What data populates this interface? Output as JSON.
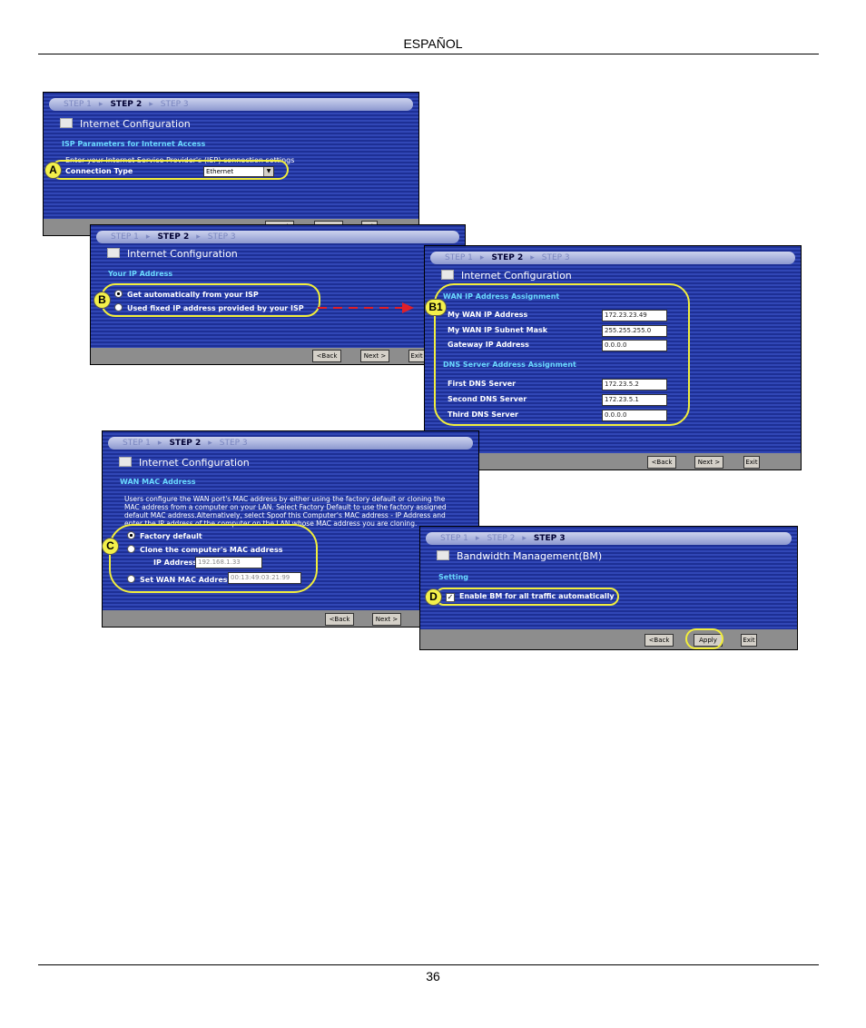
{
  "header": {
    "language": "ESPAÑOL"
  },
  "footer": {
    "page_number": "36"
  },
  "colors": {
    "highlight": "#f2ee3c",
    "window_blue": "#2a3ea8",
    "section_text": "#6ad9ff",
    "arrow": "#e0202a"
  },
  "steps": {
    "step1": "STEP 1",
    "step2": "STEP 2",
    "step3": "STEP 3"
  },
  "buttons": {
    "back": "<Back",
    "next": "Next >",
    "exit": "Exit",
    "apply": "Apply"
  },
  "window_a": {
    "title": "Internet Configuration",
    "section": "ISP Parameters for Internet Access",
    "intro": "Enter your Internet Service Provider's (ISP) connection settings",
    "connection_type_label": "Connection Type",
    "connection_type_value": "Ethernet"
  },
  "window_b": {
    "title": "Internet Configuration",
    "section": "Your IP Address",
    "option_auto": "Get automatically from your ISP",
    "option_fixed": "Used fixed IP address provided by your ISP"
  },
  "window_b1": {
    "title": "Internet Configuration",
    "wan_section": "WAN IP Address Assignment",
    "dns_section": "DNS Server Address Assignment",
    "fields": [
      {
        "label": "My WAN IP Address",
        "value": "172.23.23.49"
      },
      {
        "label": "My WAN IP Subnet Mask",
        "value": "255.255.255.0"
      },
      {
        "label": "Gateway IP Address",
        "value": "0.0.0.0"
      }
    ],
    "dns_fields": [
      {
        "label": "First DNS Server",
        "value": "172.23.5.2"
      },
      {
        "label": "Second DNS Server",
        "value": "172.23.5.1"
      },
      {
        "label": "Third DNS Server",
        "value": "0.0.0.0"
      }
    ]
  },
  "window_c": {
    "title": "Internet Configuration",
    "section": "WAN MAC Address",
    "description_lines": [
      "Users configure the WAN port's MAC address by either using the factory default or cloning the",
      "MAC address from a computer on your LAN. Select Factory Default to use the factory assigned",
      "default MAC address.Alternatively, select Spoof this Computer's MAC address - IP Address and",
      "enter the IP address of the computer on the LAN whose MAC address you are cloning."
    ],
    "option_factory": "Factory default",
    "option_clone": "Clone the computer's MAC address",
    "ip_label": "IP Address",
    "ip_value": "192.168.1.33",
    "option_set": "Set WAN MAC Address",
    "mac_value": "00:13:49:03:21:99"
  },
  "window_d": {
    "title": "Bandwidth Management(BM)",
    "section": "Setting",
    "checkbox_label": "Enable BM for all traffic automatically"
  },
  "badges": {
    "a": "A",
    "b": "B",
    "b1": "B1",
    "c": "C",
    "d": "D"
  }
}
